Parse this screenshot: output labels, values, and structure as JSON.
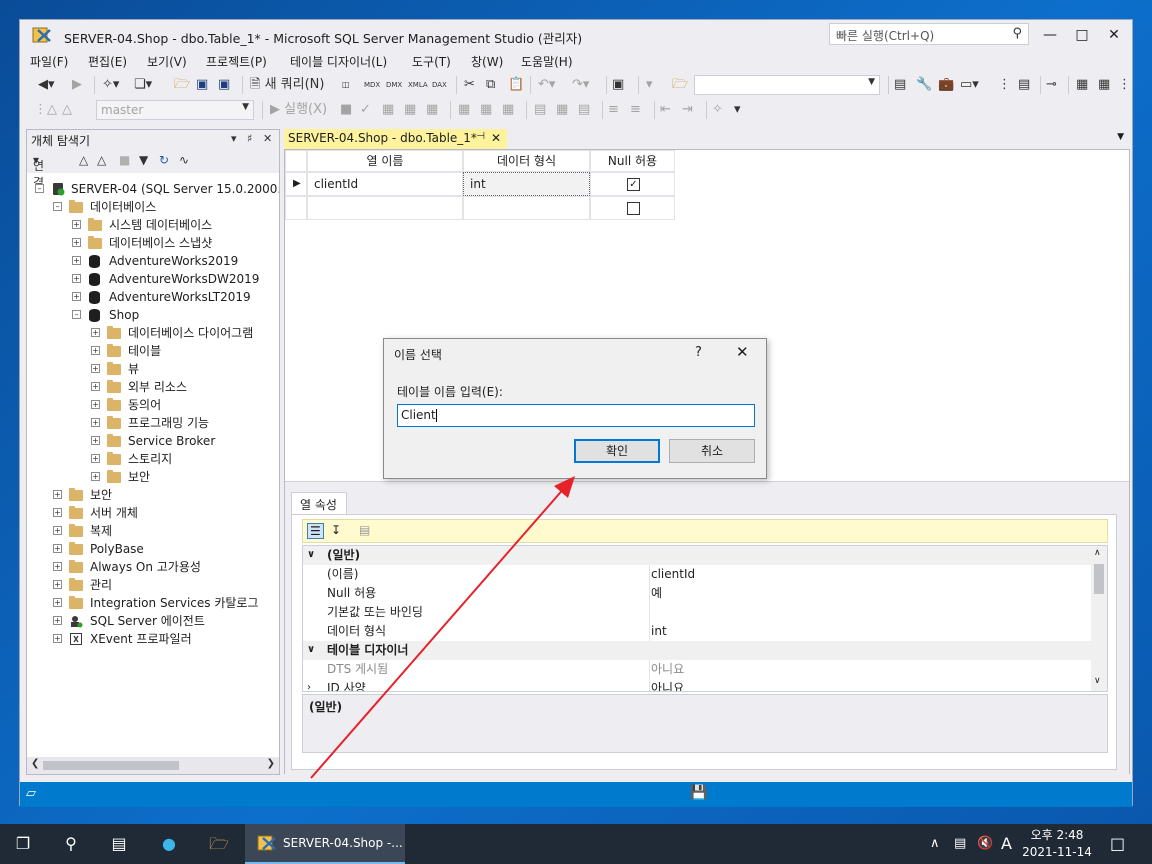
{
  "window": {
    "title": "SERVER-04.Shop - dbo.Table_1* - Microsoft SQL Server Management Studio (관리자)",
    "quick_launch_placeholder": "빠른 실행(Ctrl+Q)"
  },
  "menu": [
    "파일(F)",
    "편집(E)",
    "보기(V)",
    "프로젝트(P)",
    "테이블 디자이너(L)",
    "도구(T)",
    "창(W)",
    "도움말(H)"
  ],
  "toolbar": {
    "new_query": "새 쿼리(N)",
    "db_combo": "master",
    "execute": "실행(X)",
    "mdx": "MDX",
    "dmx": "DMX",
    "xmla": "XMLA",
    "dax": "DAX"
  },
  "object_explorer": {
    "title": "개체 탐색기",
    "connect": "연결",
    "server": "SERVER-04 (SQL Server 15.0.2000.5 -",
    "databases": "데이터베이스",
    "system_db": "시스템 데이터베이스",
    "db_snapshots": "데이터베이스 스냅샷",
    "db1": "AdventureWorks2019",
    "db2": "AdventureWorksDW2019",
    "db3": "AdventureWorksLT2019",
    "shop": "Shop",
    "shop_children": [
      "데이터베이스 다이어그램",
      "테이블",
      "뷰",
      "외부 리소스",
      "동의어",
      "프로그래밍 기능",
      "Service Broker",
      "스토리지",
      "보안"
    ],
    "server_children": [
      "보안",
      "서버 개체",
      "복제",
      "PolyBase",
      "Always On 고가용성",
      "관리",
      "Integration Services 카탈로그"
    ],
    "agent": "SQL Server 에이전트",
    "xevent": "XEvent 프로파일러"
  },
  "document": {
    "tab_title": "SERVER-04.Shop - dbo.Table_1*",
    "columns_header": {
      "name": "열 이름",
      "type": "데이터 형식",
      "null": "Null 허용"
    },
    "rows": [
      {
        "name": "clientId",
        "type": "int",
        "allow_null": true
      },
      {
        "name": "",
        "type": "",
        "allow_null": false
      }
    ]
  },
  "column_properties": {
    "tab": "열 속성",
    "cat_general": "(일반)",
    "rows": [
      {
        "k": "(이름)",
        "v": "clientId"
      },
      {
        "k": "Null 허용",
        "v": "예"
      },
      {
        "k": "기본값 또는 바인딩",
        "v": ""
      },
      {
        "k": "데이터 형식",
        "v": "int"
      }
    ],
    "cat_designer": "테이블 디자이너",
    "rows2": [
      {
        "k": "DTS 게시됨",
        "v": "아니요"
      },
      {
        "k": "ID 사양",
        "v": "아니요"
      }
    ],
    "description": "(일반)"
  },
  "dialog": {
    "title": "이름 선택",
    "help": "?",
    "label": "테이블 이름 입력(E):",
    "value": "Client",
    "ok": "확인",
    "cancel": "취소"
  },
  "taskbar": {
    "task_label": "SERVER-04.Shop -...",
    "ime": "A",
    "time": "오후 2:48",
    "date": "2021-11-14"
  },
  "colors": {
    "accent": "#007acc",
    "tab_active": "#fff29d",
    "arrow": "#e8222a"
  }
}
